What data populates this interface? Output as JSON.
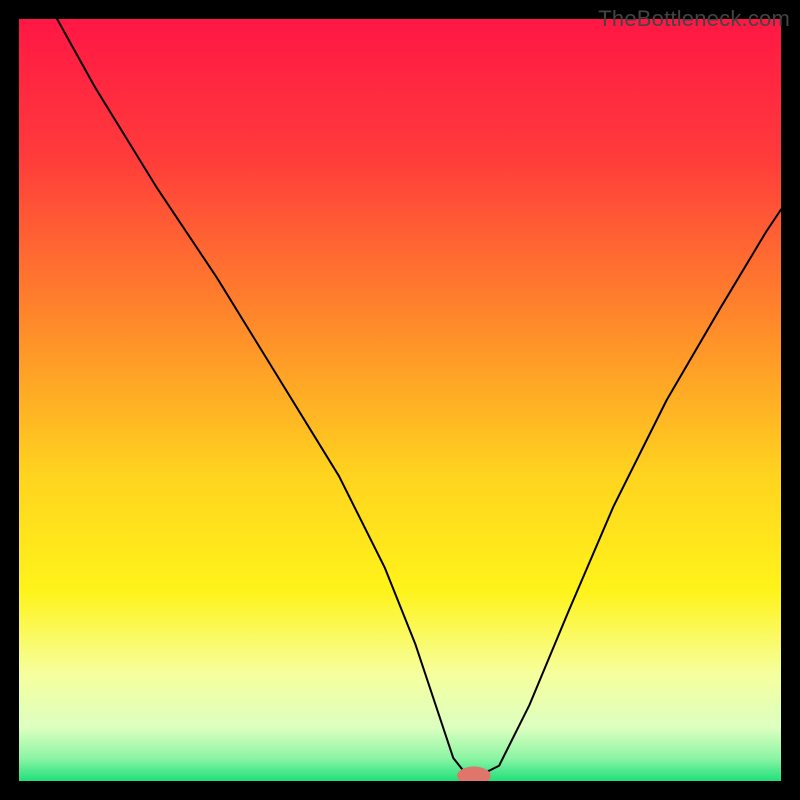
{
  "watermark": "TheBottleneck.com",
  "chart_data": {
    "type": "line",
    "title": "",
    "xlabel": "",
    "ylabel": "",
    "xlim": [
      0,
      100
    ],
    "ylim": [
      0,
      100
    ],
    "gradient_stops": [
      {
        "offset": 0,
        "color": "#ff1745"
      },
      {
        "offset": 18,
        "color": "#ff3b3b"
      },
      {
        "offset": 40,
        "color": "#ff8a2a"
      },
      {
        "offset": 60,
        "color": "#ffd41f"
      },
      {
        "offset": 75,
        "color": "#fff31a"
      },
      {
        "offset": 86,
        "color": "#f6ff9e"
      },
      {
        "offset": 93,
        "color": "#dcffc0"
      },
      {
        "offset": 97,
        "color": "#8cf5a5"
      },
      {
        "offset": 100,
        "color": "#1fe07a"
      }
    ],
    "series": [
      {
        "name": "bottleneck-curve",
        "x": [
          5,
          10,
          18,
          26,
          34,
          42,
          48,
          52,
          55,
          57,
          59,
          60,
          63,
          67,
          72,
          78,
          85,
          92,
          98,
          100
        ],
        "y": [
          100,
          91,
          78,
          66,
          53,
          40,
          28,
          18,
          9,
          3,
          0.5,
          0.5,
          2,
          10,
          22,
          36,
          50,
          62,
          72,
          75
        ]
      }
    ],
    "marker": {
      "x": 59.7,
      "y": 0.7,
      "color": "#e0756b",
      "rx": 2.2,
      "ry": 1.2
    }
  }
}
